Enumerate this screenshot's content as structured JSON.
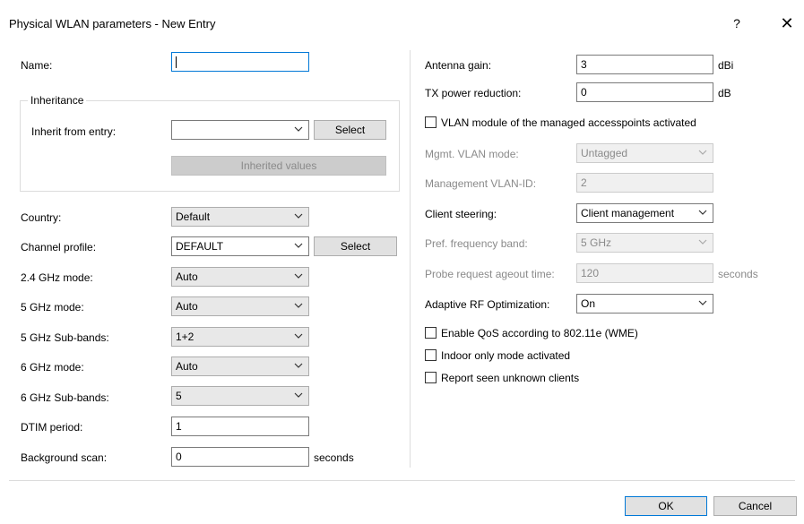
{
  "window": {
    "title": "Physical WLAN parameters - New Entry",
    "help_symbol": "?",
    "close_symbol": "✕"
  },
  "left": {
    "name_label": "Name:",
    "name_value": "",
    "inheritance": {
      "legend": "Inheritance",
      "inherit_label": "Inherit from entry:",
      "inherit_value": "",
      "select_label": "Select",
      "inherited_values_label": "Inherited values"
    },
    "country": {
      "label": "Country:",
      "value": "Default"
    },
    "channel_profile": {
      "label": "Channel profile:",
      "value": "DEFAULT",
      "select_label": "Select"
    },
    "ghz24_mode": {
      "label": "2.4 GHz mode:",
      "value": "Auto"
    },
    "ghz5_mode": {
      "label": "5 GHz mode:",
      "value": "Auto"
    },
    "ghz5_subbands": {
      "label": "5 GHz Sub-bands:",
      "value": "1+2"
    },
    "ghz6_mode": {
      "label": "6 GHz mode:",
      "value": "Auto"
    },
    "ghz6_subbands": {
      "label": "6 GHz Sub-bands:",
      "value": "5"
    },
    "dtim": {
      "label": "DTIM period:",
      "value": "1"
    },
    "bg_scan": {
      "label": "Background scan:",
      "value": "0",
      "unit": "seconds"
    }
  },
  "right": {
    "antenna_gain": {
      "label": "Antenna gain:",
      "value": "3",
      "unit": "dBi"
    },
    "tx_power": {
      "label": "TX power reduction:",
      "value": "0",
      "unit": "dB"
    },
    "vlan_module": {
      "label": "VLAN module of the managed accesspoints activated",
      "checked": false
    },
    "mgmt_vlan_mode": {
      "label": "Mgmt. VLAN mode:",
      "value": "Untagged"
    },
    "mgmt_vlan_id": {
      "label": "Management VLAN-ID:",
      "value": "2"
    },
    "client_steering": {
      "label": "Client steering:",
      "value": "Client management"
    },
    "pref_band": {
      "label": "Pref. frequency band:",
      "value": "5 GHz"
    },
    "probe_ageout": {
      "label": "Probe request ageout time:",
      "value": "120",
      "unit": "seconds"
    },
    "adaptive_rf": {
      "label": "Adaptive RF Optimization:",
      "value": "On"
    },
    "qos": {
      "label": "Enable QoS according to 802.11e (WME)",
      "checked": false
    },
    "indoor": {
      "label": "Indoor only mode activated",
      "checked": false
    },
    "report_unknown": {
      "label": "Report seen unknown clients",
      "checked": false
    }
  },
  "footer": {
    "ok_label": "OK",
    "cancel_label": "Cancel"
  }
}
